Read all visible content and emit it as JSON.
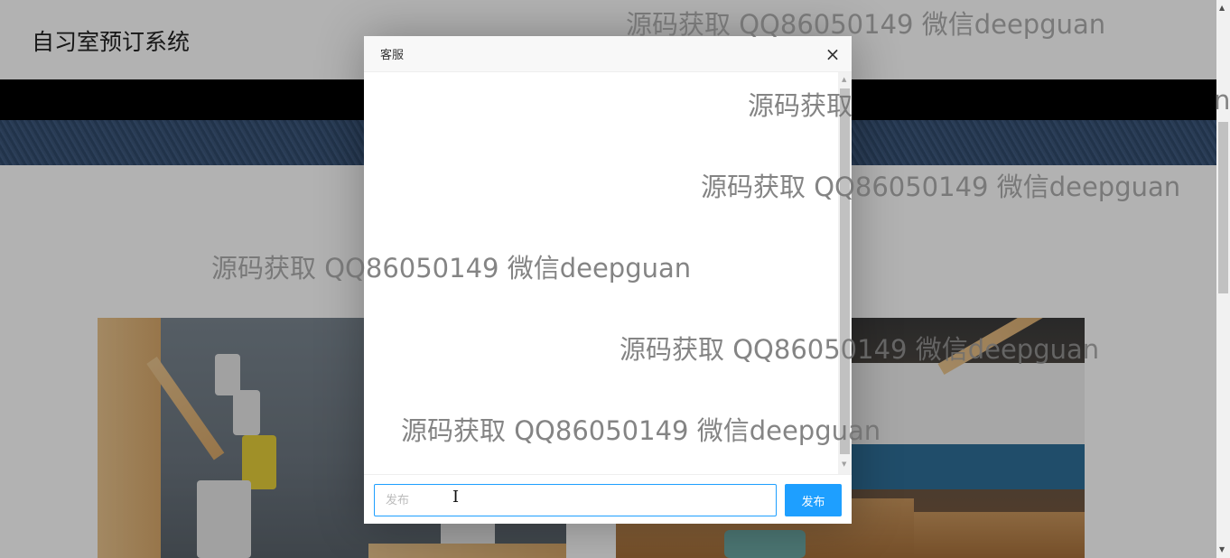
{
  "site": {
    "title": "自习室预订系统"
  },
  "dialog": {
    "title": "客服",
    "close_glyph": "×",
    "input_placeholder": "发布",
    "send_label": "发布"
  },
  "watermark": {
    "text_full": "源码获取 QQ86050149 微信deepguan",
    "text_partial": "源码获取",
    "text_edge": "n"
  },
  "colors": {
    "accent": "#1e9fff",
    "nav": "#000000",
    "banner": "#34506f"
  },
  "icons": {
    "close": "close-icon",
    "cursor": "text-cursor-icon"
  }
}
